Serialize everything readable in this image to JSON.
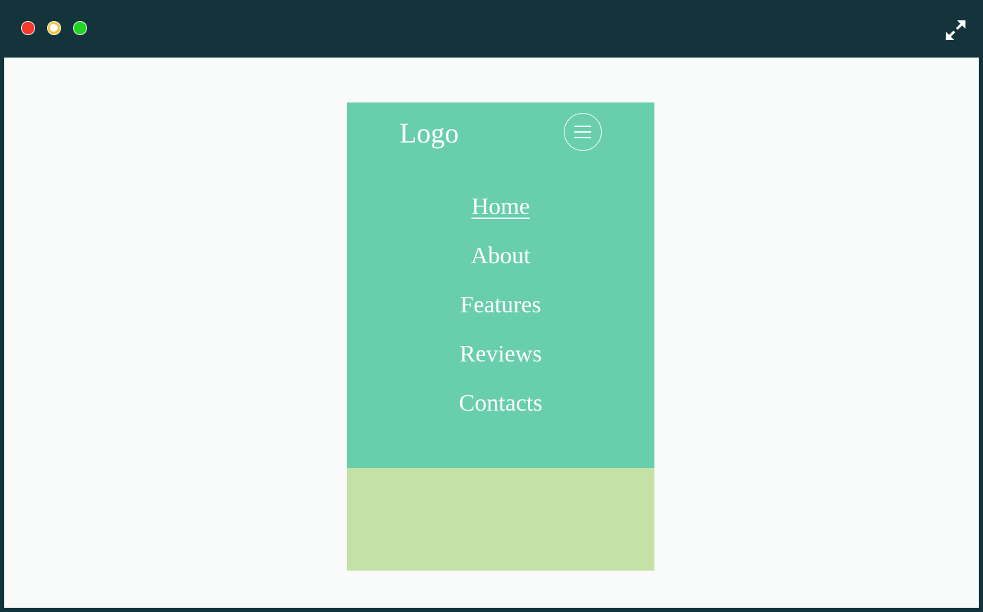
{
  "window": {
    "controls": [
      "close",
      "minimize",
      "maximize"
    ],
    "expand_icon": "expand-arrows-icon",
    "frame_color": "#12343a"
  },
  "site": {
    "logo": "Logo",
    "menu_icon": "hamburger-menu-icon",
    "nav_items": [
      {
        "label": "Home",
        "active": true
      },
      {
        "label": "About",
        "active": false
      },
      {
        "label": "Features",
        "active": false
      },
      {
        "label": "Reviews",
        "active": false
      },
      {
        "label": "Contacts",
        "active": false
      }
    ],
    "colors": {
      "nav_background": "#69ceab",
      "content_background": "#c6e1a6",
      "page_background": "#f9fafa"
    }
  }
}
